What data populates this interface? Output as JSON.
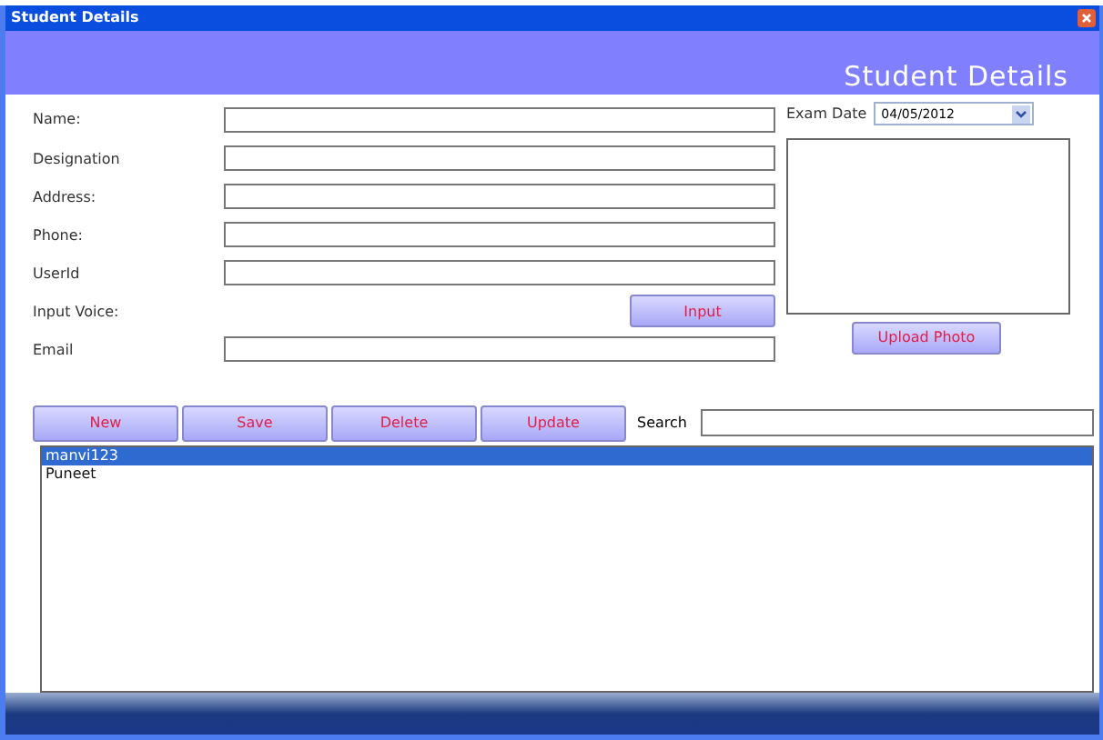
{
  "window": {
    "title": "Student Details"
  },
  "header": {
    "title": "Student Details"
  },
  "fields": [
    {
      "label": "Name:",
      "kind": "text"
    },
    {
      "label": "Designation",
      "kind": "text"
    },
    {
      "label": "Address:",
      "kind": "text"
    },
    {
      "label": "Phone:",
      "kind": "text"
    },
    {
      "label": "UserId",
      "kind": "text"
    },
    {
      "label": "Input Voice:",
      "kind": "button",
      "button": "Input"
    },
    {
      "label": "Email",
      "kind": "text"
    }
  ],
  "exam_date": {
    "label": "Exam Date",
    "value": "04/05/2012"
  },
  "upload_button": "Upload Photo",
  "actions": [
    "New",
    "Save",
    "Delete",
    "Update"
  ],
  "search": {
    "label": "Search"
  },
  "list": [
    {
      "text": "manvi123",
      "selected": true
    },
    {
      "text": "Puneet",
      "selected": false
    }
  ]
}
